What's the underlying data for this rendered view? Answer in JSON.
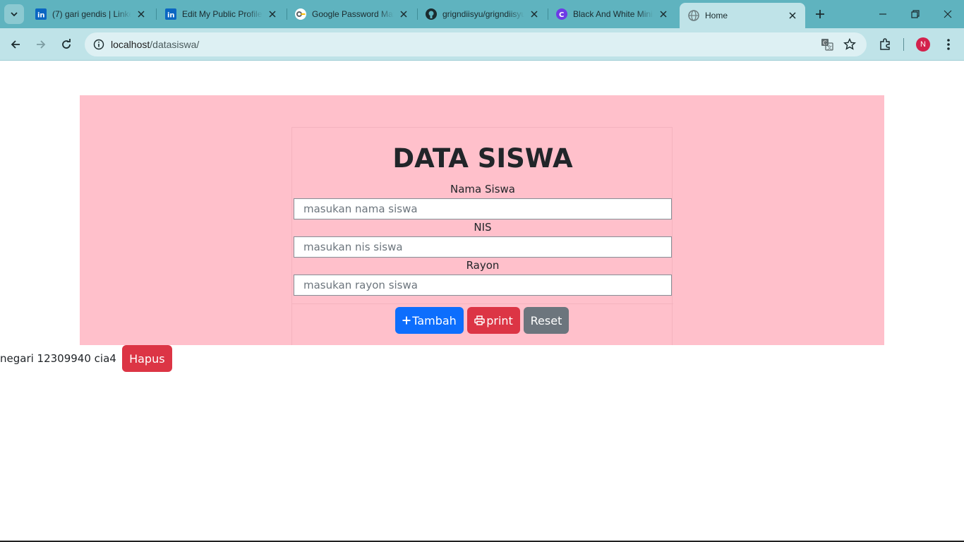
{
  "browser": {
    "tabs": [
      {
        "title": "(7) gari gendis | LinkedIn",
        "favicon": "linkedin-icon",
        "active": false
      },
      {
        "title": "Edit My Public Profile | LinkedIn",
        "favicon": "linkedin-icon",
        "active": false
      },
      {
        "title": "Google Password Manager",
        "favicon": "google-password-icon",
        "active": false
      },
      {
        "title": "grigndiisyu/grigndiisyu",
        "favicon": "github-icon",
        "active": false
      },
      {
        "title": "Black And White Minimalist",
        "favicon": "canva-icon",
        "active": false
      },
      {
        "title": "Home",
        "favicon": "globe-icon",
        "active": true
      }
    ],
    "address": {
      "host": "localhost",
      "path": "/datasiswa/"
    },
    "profile_initial": "N",
    "colors": {
      "tabstrip": "#5fb3bf",
      "toolbar": "#bfe3e8",
      "avatar": "#d3224c"
    }
  },
  "form": {
    "heading": "DATA SISWA",
    "fields": [
      {
        "label": "Nama Siswa",
        "placeholder": "masukan nama siswa"
      },
      {
        "label": "NIS",
        "placeholder": "masukan nis siswa"
      },
      {
        "label": "Rayon",
        "placeholder": "masukan rayon siswa"
      }
    ],
    "buttons": {
      "tambah": "Tambah",
      "print": "print",
      "reset": "Reset"
    },
    "colors": {
      "container": "#ffc0cb",
      "primary": "#0d6efd",
      "danger": "#dc3545",
      "secondary": "#6c757d"
    }
  },
  "records": [
    {
      "text": "negari 12309940 cia4",
      "delete_label": "Hapus"
    }
  ]
}
